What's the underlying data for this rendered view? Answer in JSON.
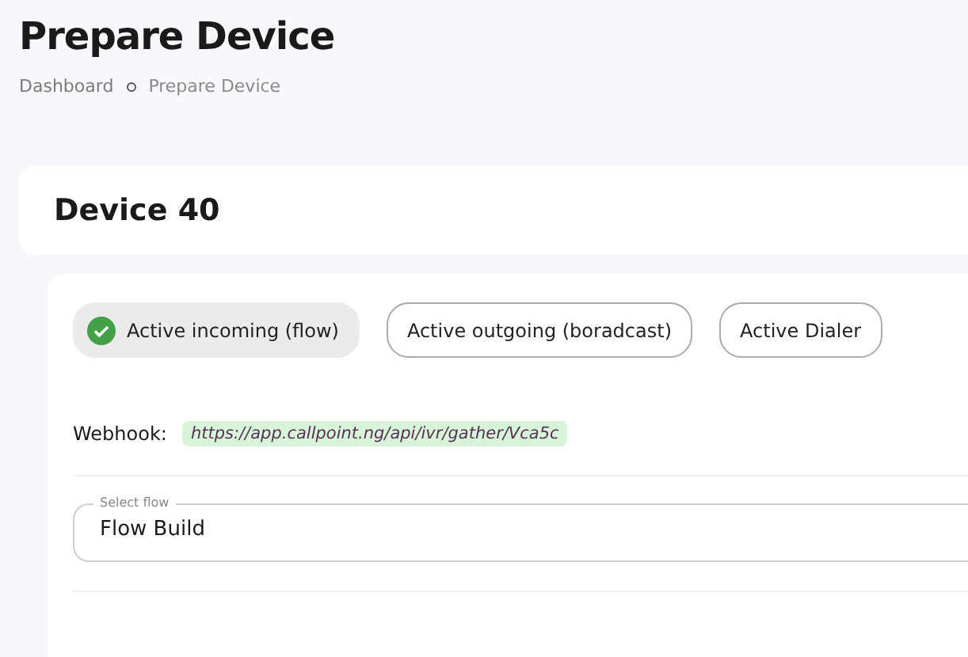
{
  "page": {
    "title": "Prepare Device"
  },
  "breadcrumb": [
    "Dashboard",
    "Prepare Device"
  ],
  "device": {
    "title": "Device 40"
  },
  "modes": [
    {
      "label": "Active incoming (flow)",
      "selected": true
    },
    {
      "label": "Active outgoing (boradcast)",
      "selected": false
    },
    {
      "label": "Active Dialer",
      "selected": false
    }
  ],
  "webhook": {
    "label": "Webhook:",
    "url": "https://app.callpoint.ng/api/ivr/gather/Vca5c"
  },
  "flow_select": {
    "label": "Select flow",
    "value": "Flow Build"
  }
}
